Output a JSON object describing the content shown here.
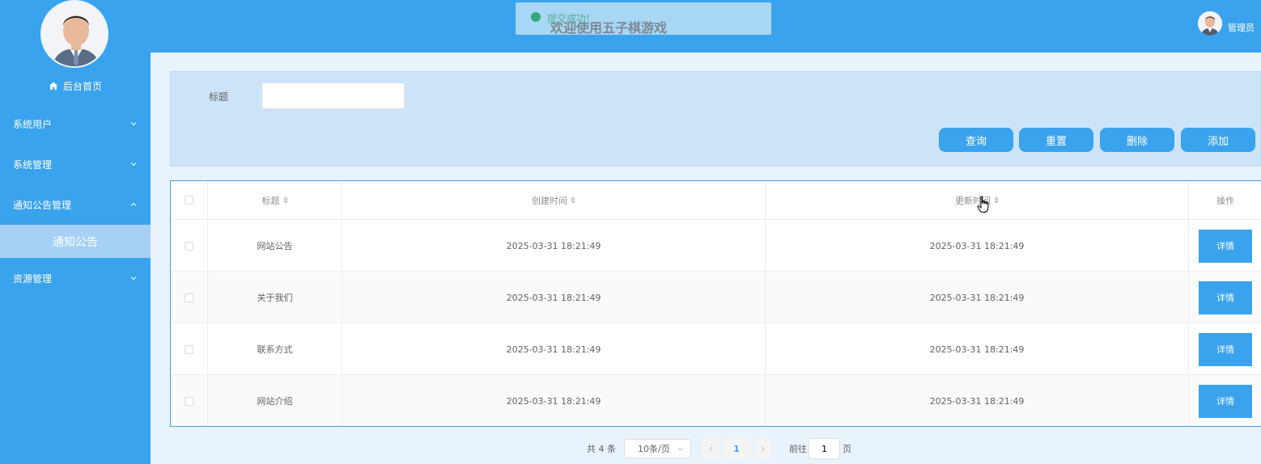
{
  "sidebar": {
    "home_label": "后台首页",
    "menus": [
      {
        "label": "系统用户",
        "expanded": false
      },
      {
        "label": "系统管理",
        "expanded": false
      },
      {
        "label": "通知公告管理",
        "expanded": true
      },
      {
        "label": "资源管理",
        "expanded": false
      }
    ],
    "active_submenu": "通知公告"
  },
  "header": {
    "title": "欢迎使用五子棋游戏",
    "toast": "提交成功!",
    "user_name": "管理员"
  },
  "search": {
    "label": "标题",
    "value": "",
    "buttons": {
      "query": "查询",
      "reset": "重置",
      "delete": "删除",
      "add": "添加"
    }
  },
  "table": {
    "headers": {
      "title": "标题",
      "created": "创建时间",
      "updated": "更新时间",
      "actions": "操作"
    },
    "rows": [
      {
        "title": "网站公告",
        "created": "2025-03-31 18:21:49",
        "updated": "2025-03-31 18:21:49",
        "action": "详情"
      },
      {
        "title": "关于我们",
        "created": "2025-03-31 18:21:49",
        "updated": "2025-03-31 18:21:49",
        "action": "详情"
      },
      {
        "title": "联系方式",
        "created": "2025-03-31 18:21:49",
        "updated": "2025-03-31 18:21:49",
        "action": "详情"
      },
      {
        "title": "网站介绍",
        "created": "2025-03-31 18:21:49",
        "updated": "2025-03-31 18:21:49",
        "action": "详情"
      }
    ]
  },
  "pagination": {
    "total": "共 4 条",
    "page_size": "10条/页",
    "current_page": "1",
    "goto_label": "前往",
    "goto_value": "1",
    "page_unit": "页"
  },
  "colors": {
    "primary": "#3aa3ee",
    "panel": "#cce4f8",
    "submenu_active": "#a7d1f4"
  }
}
